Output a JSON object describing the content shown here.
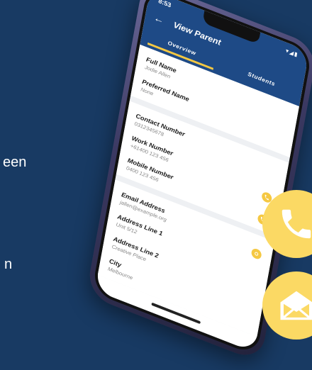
{
  "background_text": {
    "line1": "een",
    "line2": "n"
  },
  "status": {
    "time": "8:53",
    "alarm_icon": "alarm-icon",
    "signal": "▾◢▮"
  },
  "appbar": {
    "back_icon": "arrow-left-icon",
    "title": "View Parent"
  },
  "tabs": [
    {
      "label": "Overview",
      "active": true
    },
    {
      "label": "Students",
      "active": false
    }
  ],
  "sections": {
    "name": [
      {
        "label": "Full Name",
        "value": "Jodie Allen"
      },
      {
        "label": "Preferred Name",
        "value": "None"
      }
    ],
    "contact": [
      {
        "label": "Contact Number",
        "value": "0312345678",
        "call": false
      },
      {
        "label": "Work Number",
        "value": "+61400 123 456",
        "call": true
      },
      {
        "label": "Mobile Number",
        "value": "0400 123 456",
        "call": true
      }
    ],
    "address": [
      {
        "label": "Email Address",
        "value": "jallen@example.org",
        "action": true
      },
      {
        "label": "Address Line 1",
        "value": "Unit 5/12"
      },
      {
        "label": "Address Line 2",
        "value": "Creative Place"
      },
      {
        "label": "City",
        "value": "Melbourne"
      }
    ]
  },
  "colors": {
    "background": "#183a63",
    "appbar": "#1e4a86",
    "accent": "#f5c842",
    "big_circle": "#fbd964"
  },
  "icons": {
    "phone_circle": "phone-icon",
    "mail_circle": "envelope-open-icon"
  }
}
